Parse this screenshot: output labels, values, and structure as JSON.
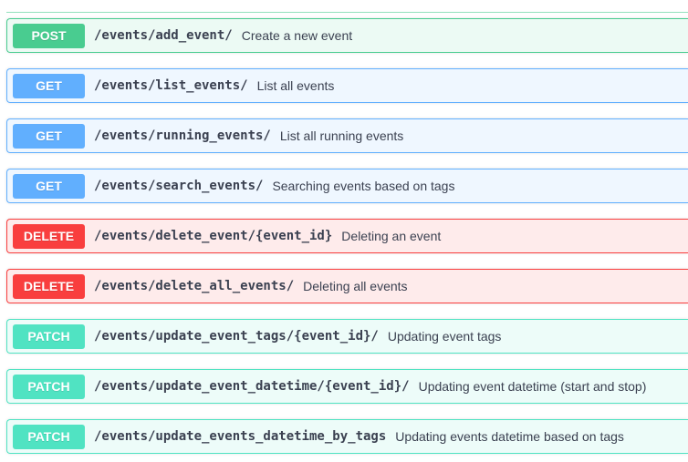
{
  "operations": [
    {
      "method": "POST",
      "path": "/events/add_event/",
      "summary": "Create a new event"
    },
    {
      "method": "GET",
      "path": "/events/list_events/",
      "summary": "List all events"
    },
    {
      "method": "GET",
      "path": "/events/running_events/",
      "summary": "List all running events"
    },
    {
      "method": "GET",
      "path": "/events/search_events/",
      "summary": "Searching events based on tags"
    },
    {
      "method": "DELETE",
      "path": "/events/delete_event/{event_id}",
      "summary": "Deleting an event"
    },
    {
      "method": "DELETE",
      "path": "/events/delete_all_events/",
      "summary": "Deleting all events"
    },
    {
      "method": "PATCH",
      "path": "/events/update_event_tags/{event_id}/",
      "summary": "Updating event tags"
    },
    {
      "method": "PATCH",
      "path": "/events/update_event_datetime/{event_id}/",
      "summary": "Updating event datetime (start and stop)"
    },
    {
      "method": "PATCH",
      "path": "/events/update_events_datetime_by_tags",
      "summary": "Updating events datetime based on tags"
    }
  ],
  "colors": {
    "post": "#49cc90",
    "get": "#61affe",
    "delete": "#f93e3e",
    "patch": "#50e3c2",
    "text": "#3b4151"
  }
}
